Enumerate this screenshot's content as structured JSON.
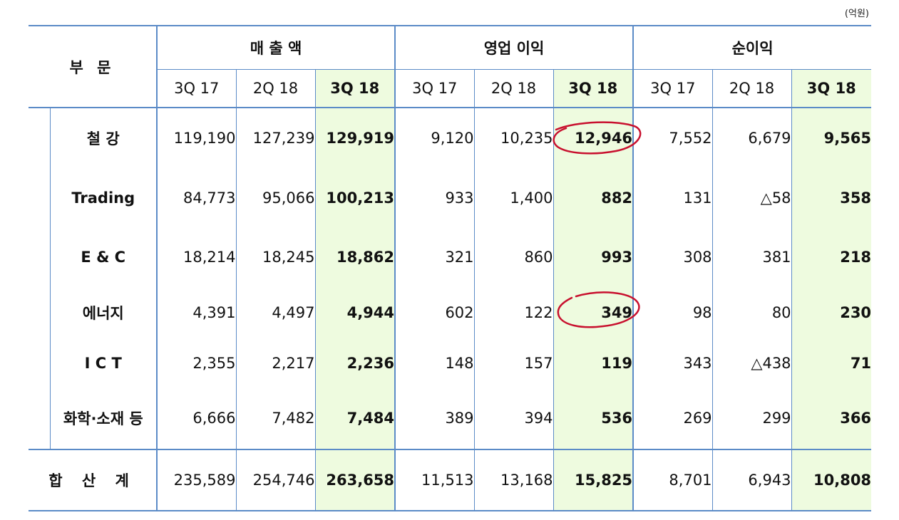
{
  "unit": "(억원)",
  "header": {
    "part": "부 문",
    "groups": [
      "매 출 액",
      "영업 이익",
      "순이익"
    ],
    "periods": [
      "3Q 17",
      "2Q 18",
      "3Q 18"
    ]
  },
  "rows": [
    {
      "label": "철    강",
      "values": [
        "119,190",
        "127,239",
        "129,919",
        "9,120",
        "10,235",
        "12,946",
        "7,552",
        "6,679",
        "9,565"
      ]
    },
    {
      "label": "Trading",
      "values": [
        "84,773",
        "95,066",
        "100,213",
        "933",
        "1,400",
        "882",
        "131",
        "△58",
        "358"
      ]
    },
    {
      "label": "E  & C",
      "values": [
        "18,214",
        "18,245",
        "18,862",
        "321",
        "860",
        "993",
        "308",
        "381",
        "218"
      ]
    },
    {
      "label": "에너지",
      "values": [
        "4,391",
        "4,497",
        "4,944",
        "602",
        "122",
        "349",
        "98",
        "80",
        "230"
      ]
    },
    {
      "label": "I  C  T",
      "values": [
        "2,355",
        "2,217",
        "2,236",
        "148",
        "157",
        "119",
        "343",
        "△438",
        "71"
      ]
    },
    {
      "label": "화학·소재 등",
      "values": [
        "6,666",
        "7,482",
        "7,484",
        "389",
        "394",
        "536",
        "269",
        "299",
        "366"
      ]
    }
  ],
  "total": {
    "label": "합 산  계",
    "values": [
      "235,589",
      "254,746",
      "263,658",
      "11,513",
      "13,168",
      "15,825",
      "8,701",
      "6,943",
      "10,808"
    ]
  },
  "colors": {
    "border": "#5b8bc7",
    "highlight": "#eefbdf",
    "circle": "#c8102e"
  }
}
